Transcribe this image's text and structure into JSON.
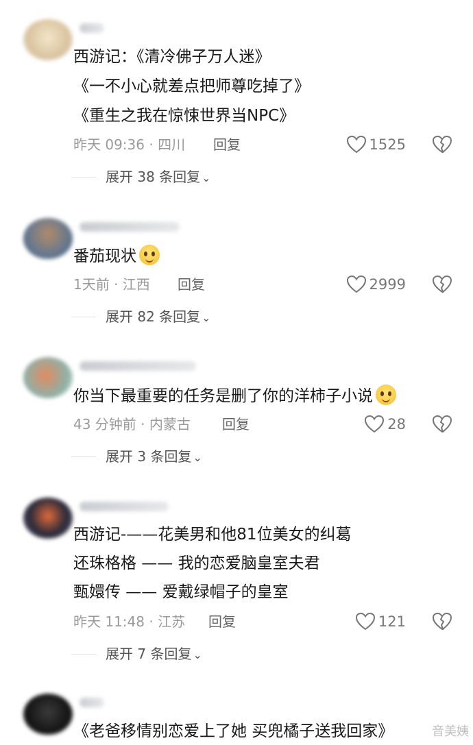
{
  "comments": [
    {
      "lines": [
        "西游记：《清冷佛子万人迷》",
        "《一不小心就差点把师尊吃掉了》",
        "《重生之我在惊悚世界当NPC》"
      ],
      "meta": "昨天 09:36 · 四川",
      "reply": "回复",
      "likes": "1525",
      "expand": "展开 38 条回复"
    },
    {
      "lines": [
        "番茄现状"
      ],
      "meta": "1天前 · 江西",
      "reply": "回复",
      "likes": "2999",
      "expand": "展开 82 条回复"
    },
    {
      "lines": [
        "你当下最重要的任务是删了你的洋柿子小说"
      ],
      "meta": "43 分钟前 · 内蒙古",
      "reply": "回复",
      "likes": "28",
      "expand": "展开 3 条回复"
    },
    {
      "lines": [
        "西游记-——花美男和他81位美女的纠葛",
        "还珠格格 —— 我的恋爱脑皇室夫君",
        "甄嬛传  —— 爱戴绿帽子的皇室"
      ],
      "meta": "昨天 11:48 · 江苏",
      "reply": "回复",
      "likes": "121",
      "expand": "展开 7 条回复"
    },
    {
      "lines": [
        "《老爸移情别恋爱上了她 买兜橘子送我回家》"
      ]
    }
  ],
  "watermark": "音美姨",
  "icons": {
    "like": "heart-outline-icon",
    "dislike": "broken-heart-icon",
    "expand": "chevron-down-icon",
    "emoji": "smiley-emoji-icon"
  },
  "colors": {
    "text": "#1a1a1a",
    "meta": "#9a9a9a",
    "reply": "#666666",
    "background": "#ffffff"
  }
}
